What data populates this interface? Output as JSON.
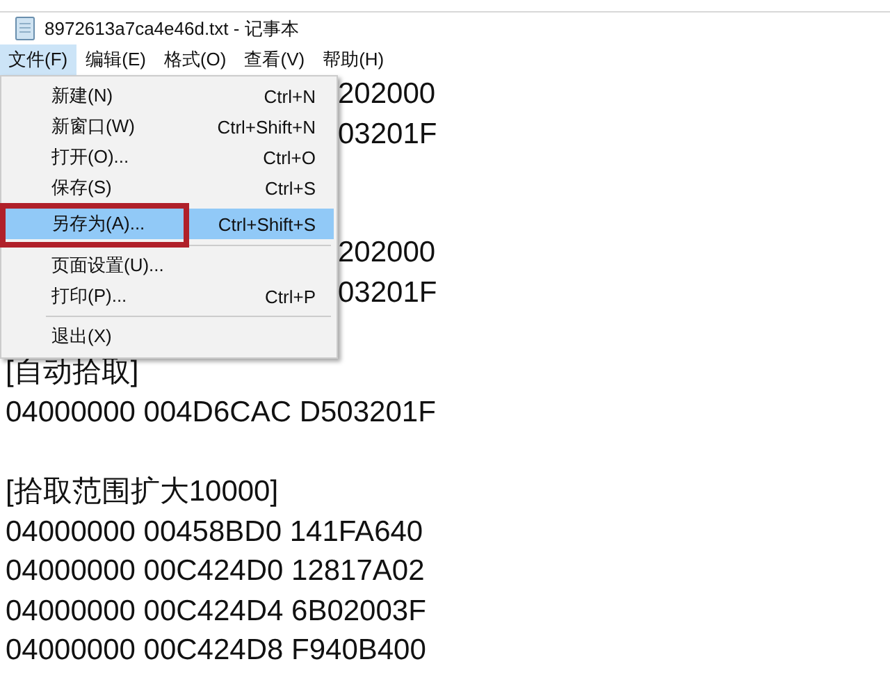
{
  "window": {
    "title": "8972613a7ca4e46d.txt - 记事本"
  },
  "menubar": [
    {
      "label": "文件(F)",
      "selected": true
    },
    {
      "label": "编辑(E)",
      "selected": false
    },
    {
      "label": "格式(O)",
      "selected": false
    },
    {
      "label": "查看(V)",
      "selected": false
    },
    {
      "label": "帮助(H)",
      "selected": false
    }
  ],
  "file_menu": [
    {
      "kind": "item",
      "label": "新建(N)",
      "shortcut": "Ctrl+N",
      "selected": false,
      "annotated": false
    },
    {
      "kind": "item",
      "label": "新窗口(W)",
      "shortcut": "Ctrl+Shift+N",
      "selected": false,
      "annotated": false
    },
    {
      "kind": "item",
      "label": "打开(O)...",
      "shortcut": "Ctrl+O",
      "selected": false,
      "annotated": false
    },
    {
      "kind": "item",
      "label": "保存(S)",
      "shortcut": "Ctrl+S",
      "selected": false,
      "annotated": false
    },
    {
      "kind": "item",
      "label": "另存为(A)...",
      "shortcut": "Ctrl+Shift+S",
      "selected": true,
      "annotated": true
    },
    {
      "kind": "separator"
    },
    {
      "kind": "item",
      "label": "页面设置(U)...",
      "selected": false,
      "annotated": false
    },
    {
      "kind": "item",
      "label": "打印(P)...",
      "shortcut": "Ctrl+P",
      "selected": false,
      "annotated": false
    },
    {
      "kind": "separator"
    },
    {
      "kind": "item",
      "label": "退出(X)",
      "selected": false,
      "annotated": false
    }
  ],
  "editor_paragraphs": [
    {
      "covered": true,
      "lines": [
        "202000",
        "03201F"
      ]
    },
    {
      "covered": true,
      "lines": [
        "202000",
        "03201F"
      ]
    },
    {
      "covered": false,
      "lines": [
        "[自动拾取]",
        "04000000 004D6CAC D503201F"
      ]
    },
    {
      "covered": false,
      "lines": [
        "[拾取范围扩大10000]",
        "04000000 00458BD0 141FA640",
        "04000000 00C424D0 12817A02",
        "04000000 00C424D4 6B02003F",
        "04000000 00C424D8 F940B400"
      ]
    }
  ]
}
